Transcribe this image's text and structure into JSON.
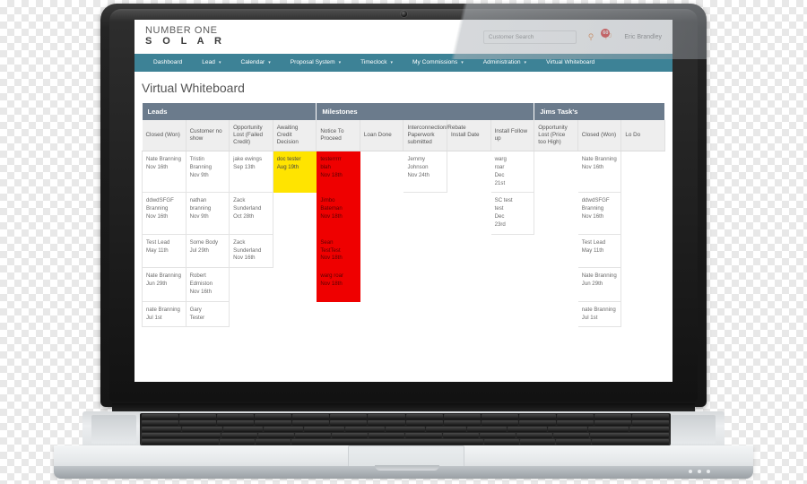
{
  "app": {
    "logo_line1": "NUMBER ONE",
    "logo_line2": "S O L A R",
    "username": "Eric Brandley",
    "notification_count": "60",
    "search_placeholder": "Customer Search",
    "search_value": "",
    "accent_nav": "#3d8296",
    "accent_group_header": "#6b7b8c",
    "accent_orange": "#e8833a",
    "status_yellow": "#ffe400",
    "status_red": "#ef0000"
  },
  "nav": {
    "items": [
      {
        "label": "Dashboard",
        "caret": false
      },
      {
        "label": "Lead",
        "caret": true
      },
      {
        "label": "Calendar",
        "caret": true
      },
      {
        "label": "Proposal System",
        "caret": true
      },
      {
        "label": "Timeclock",
        "caret": true
      },
      {
        "label": "My Commissions",
        "caret": true
      },
      {
        "label": "Administration",
        "caret": true
      },
      {
        "label": "Virtual Whiteboard",
        "caret": false
      }
    ]
  },
  "page": {
    "title": "Virtual Whiteboard"
  },
  "board": {
    "groups": [
      {
        "label": "Leads",
        "span": 4
      },
      {
        "label": "Milestones",
        "span": 5
      },
      {
        "label": "Jims Task's",
        "span": 3
      }
    ],
    "columns": [
      "Closed (Won)",
      "Customer no show",
      "Opportunity Lost (Failed Credit)",
      "Awaiting Credit Decision",
      "Notice To Proceed",
      "Loan Done",
      "Interconnection/Rebate Paperwork submitted",
      "Install Date",
      "Install Follow up",
      "Opportunity Lost (Price too High)",
      "Closed (Won)",
      "Lo Do"
    ],
    "rows": [
      [
        {
          "lines": [
            "Nate Branning",
            "Nov 16th"
          ],
          "style": "plain"
        },
        {
          "lines": [
            "Tristin",
            "Branning",
            "Nov 9th"
          ],
          "style": "plain"
        },
        {
          "lines": [
            "jake ewings",
            "Sep 13th"
          ],
          "style": "plain"
        },
        {
          "lines": [
            "doc tester",
            "Aug 19th"
          ],
          "style": "yellow"
        },
        {
          "lines": [
            "testerrrrr",
            "blah",
            "Nov 18th"
          ],
          "style": "red"
        },
        {
          "lines": [],
          "style": "empty"
        },
        {
          "lines": [
            "Jemmy Johnson",
            "Nov 24th"
          ],
          "style": "plain"
        },
        {
          "lines": [],
          "style": "empty"
        },
        {
          "lines": [
            "warg",
            "roar",
            "Dec",
            "21st"
          ],
          "style": "plain"
        },
        {
          "lines": [],
          "style": "empty"
        },
        {
          "lines": [
            "Nate Branning",
            "Nov 16th"
          ],
          "style": "plain"
        },
        {
          "lines": [],
          "style": "empty"
        }
      ],
      [
        {
          "lines": [
            "ddwdSFGF",
            "Branning",
            "Nov 16th"
          ],
          "style": "plain"
        },
        {
          "lines": [
            "nathan",
            "branning",
            "Nov 9th"
          ],
          "style": "plain"
        },
        {
          "lines": [
            "Zack",
            "Sunderland",
            "Oct 28th"
          ],
          "style": "plain"
        },
        {
          "lines": [],
          "style": "empty"
        },
        {
          "lines": [
            "Jimbo",
            "Bateman",
            "Nov 18th"
          ],
          "style": "red"
        },
        {
          "lines": [],
          "style": "empty"
        },
        {
          "lines": [],
          "style": "empty"
        },
        {
          "lines": [],
          "style": "empty"
        },
        {
          "lines": [
            "SC test",
            "test",
            "Dec",
            "23rd"
          ],
          "style": "plain"
        },
        {
          "lines": [],
          "style": "empty"
        },
        {
          "lines": [
            "ddwdSFGF",
            "Branning",
            "Nov 16th"
          ],
          "style": "plain"
        },
        {
          "lines": [],
          "style": "empty"
        }
      ],
      [
        {
          "lines": [
            "Test Lead",
            "May 11th"
          ],
          "style": "plain"
        },
        {
          "lines": [
            "Some Body",
            "Jul 29th"
          ],
          "style": "plain"
        },
        {
          "lines": [
            "Zack",
            "Sunderland",
            "Nov 16th"
          ],
          "style": "plain"
        },
        {
          "lines": [],
          "style": "empty"
        },
        {
          "lines": [
            "Sean",
            "TestTest",
            "Nov 18th"
          ],
          "style": "red"
        },
        {
          "lines": [],
          "style": "empty"
        },
        {
          "lines": [],
          "style": "empty"
        },
        {
          "lines": [],
          "style": "empty"
        },
        {
          "lines": [],
          "style": "empty"
        },
        {
          "lines": [],
          "style": "empty"
        },
        {
          "lines": [
            "Test Lead",
            "May 11th"
          ],
          "style": "plain"
        },
        {
          "lines": [],
          "style": "empty"
        }
      ],
      [
        {
          "lines": [
            "Nate Branning",
            "Jun 29th"
          ],
          "style": "plain"
        },
        {
          "lines": [
            "Robert",
            "Edmiston",
            "Nov 16th"
          ],
          "style": "plain"
        },
        {
          "lines": [],
          "style": "empty"
        },
        {
          "lines": [],
          "style": "empty"
        },
        {
          "lines": [
            "warg roar",
            "Nov 18th"
          ],
          "style": "red"
        },
        {
          "lines": [],
          "style": "empty"
        },
        {
          "lines": [],
          "style": "empty"
        },
        {
          "lines": [],
          "style": "empty"
        },
        {
          "lines": [],
          "style": "empty"
        },
        {
          "lines": [],
          "style": "empty"
        },
        {
          "lines": [
            "Nate Branning",
            "Jun 29th"
          ],
          "style": "plain"
        },
        {
          "lines": [],
          "style": "empty"
        }
      ],
      [
        {
          "lines": [
            "nate Branning",
            "Jul 1st"
          ],
          "style": "plain"
        },
        {
          "lines": [
            "Gary",
            "Tester"
          ],
          "style": "plain"
        },
        {
          "lines": [],
          "style": "empty"
        },
        {
          "lines": [],
          "style": "empty"
        },
        {
          "lines": [],
          "style": "empty"
        },
        {
          "lines": [],
          "style": "empty"
        },
        {
          "lines": [],
          "style": "empty"
        },
        {
          "lines": [],
          "style": "empty"
        },
        {
          "lines": [],
          "style": "empty"
        },
        {
          "lines": [],
          "style": "empty"
        },
        {
          "lines": [
            "nate Branning",
            "Jul 1st"
          ],
          "style": "plain"
        },
        {
          "lines": [],
          "style": "empty"
        }
      ]
    ]
  }
}
